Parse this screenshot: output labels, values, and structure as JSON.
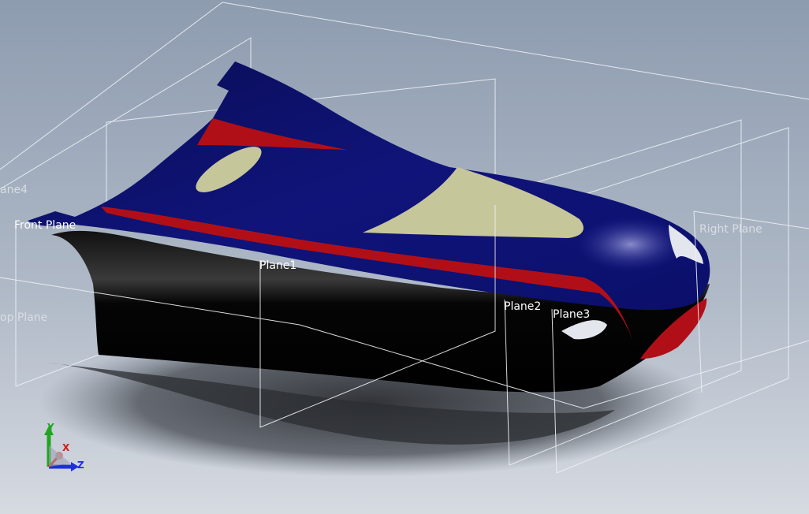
{
  "viewport": {
    "background_top": "#8D9BAF",
    "background_bottom": "#D7DBE2",
    "plane_edge_color": "#EEF1F5",
    "label_color": "#FFFFFF",
    "label_color_dim": "#D9DDE3"
  },
  "model": {
    "body_color": "#0B0F6C",
    "stripe_color": "#B10F18",
    "window_color": "#C5C59A",
    "side_color": "#040404"
  },
  "planes": {
    "front": "Front Plane",
    "plane1": "Plane1",
    "plane2": "Plane2",
    "plane3": "Plane3",
    "plane4": "ane4",
    "right": "Right Plane",
    "top": "op Plane"
  },
  "triad": {
    "x_label": "X",
    "y_label": "Y",
    "z_label": "Z",
    "x_color": "#D21A1A",
    "y_color": "#1FA51F",
    "z_color": "#1C2FD8"
  }
}
